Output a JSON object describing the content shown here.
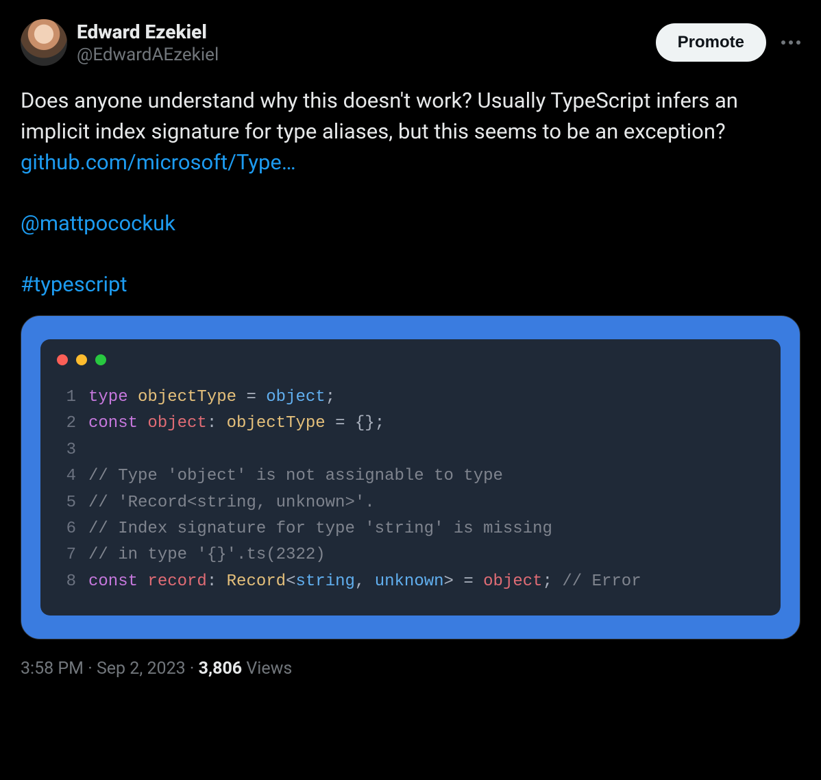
{
  "author": {
    "display_name": "Edward Ezekiel",
    "handle": "@EdwardAEzekiel"
  },
  "actions": {
    "promote_label": "Promote"
  },
  "body": {
    "text": "Does  anyone understand why this doesn't work? Usually TypeScript infers an implicit index signature for type aliases, but this seems to be an exception?  ",
    "link_text": "github.com/microsoft/Type…",
    "mention": "@mattpocockuk",
    "hashtag": "#typescript"
  },
  "code": {
    "lines": [
      {
        "n": "1",
        "tokens": [
          {
            "t": "type",
            "c": "kw"
          },
          {
            "t": " ",
            "c": "punct"
          },
          {
            "t": "objectType",
            "c": "type"
          },
          {
            "t": " = ",
            "c": "punct"
          },
          {
            "t": "object",
            "c": "typec"
          },
          {
            "t": ";",
            "c": "punct"
          }
        ]
      },
      {
        "n": "2",
        "tokens": [
          {
            "t": "const",
            "c": "kw"
          },
          {
            "t": " ",
            "c": "punct"
          },
          {
            "t": "object",
            "c": "var"
          },
          {
            "t": ": ",
            "c": "punct"
          },
          {
            "t": "objectType",
            "c": "type"
          },
          {
            "t": " = {};",
            "c": "punct"
          }
        ]
      },
      {
        "n": "3",
        "tokens": [
          {
            "t": "",
            "c": "punct"
          }
        ]
      },
      {
        "n": "4",
        "tokens": [
          {
            "t": "// Type 'object' is not assignable to type",
            "c": "comment"
          }
        ]
      },
      {
        "n": "5",
        "tokens": [
          {
            "t": "// 'Record<string, unknown>'.",
            "c": "comment"
          }
        ]
      },
      {
        "n": "6",
        "tokens": [
          {
            "t": "// Index signature for type 'string' is missing",
            "c": "comment"
          }
        ]
      },
      {
        "n": "7",
        "tokens": [
          {
            "t": "// in type '{}'.ts(2322)",
            "c": "comment"
          }
        ]
      },
      {
        "n": "8",
        "tokens": [
          {
            "t": "const",
            "c": "kw"
          },
          {
            "t": " ",
            "c": "punct"
          },
          {
            "t": "record",
            "c": "var"
          },
          {
            "t": ": ",
            "c": "punct"
          },
          {
            "t": "Record",
            "c": "type"
          },
          {
            "t": "<",
            "c": "punct"
          },
          {
            "t": "string",
            "c": "typec"
          },
          {
            "t": ", ",
            "c": "punct"
          },
          {
            "t": "unknown",
            "c": "typec"
          },
          {
            "t": "> = ",
            "c": "punct"
          },
          {
            "t": "object",
            "c": "var"
          },
          {
            "t": "; ",
            "c": "punct"
          },
          {
            "t": "// Error",
            "c": "comment"
          }
        ]
      }
    ]
  },
  "meta": {
    "time": "3:58 PM",
    "date": "Sep 2, 2023",
    "views_count": "3,806",
    "views_label": "Views",
    "sep": " · "
  }
}
